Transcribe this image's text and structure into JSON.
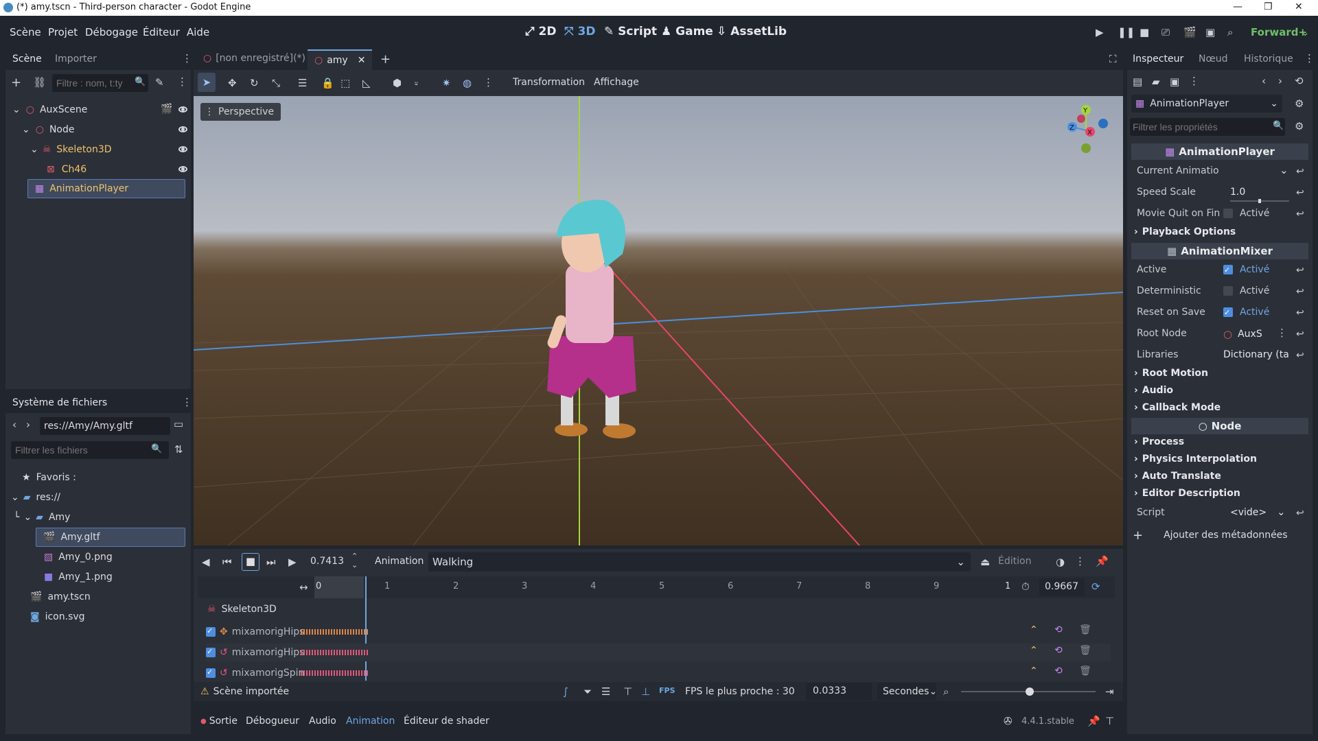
{
  "window": {
    "title": "(*) amy.tscn - Third-person character - Godot Engine"
  },
  "menu": [
    "Scène",
    "Projet",
    "Débogage",
    "Éditeur",
    "Aide"
  ],
  "workspaces": {
    "w2d": "2D",
    "w3d": "3D",
    "script": "Script",
    "game": "Game",
    "assetlib": "AssetLib"
  },
  "renderer": "Forward+",
  "scene_dock": {
    "tabs": [
      "Scène",
      "Importer"
    ],
    "filter_placeholder": "Filtre : nom, t:ty",
    "tree": [
      "AuxScene",
      "Node",
      "Skeleton3D",
      "Ch46",
      "AnimationPlayer"
    ]
  },
  "fs_dock": {
    "title": "Système de fichiers",
    "path": "res://Amy/Amy.gltf",
    "filter_placeholder": "Filtrer les fichiers",
    "items": [
      "Favoris :",
      "res://",
      "Amy",
      "Amy.gltf",
      "Amy_0.png",
      "Amy_1.png",
      "amy.tscn",
      "icon.svg"
    ]
  },
  "editor_tabs": [
    "[non enregistré](*)",
    "amy"
  ],
  "viewport": {
    "toolbar_menus": [
      "Transformation",
      "Affichage"
    ],
    "perspective": "Perspective",
    "gizmo": {
      "y": "Y",
      "x": "X",
      "z": "Z"
    }
  },
  "animation": {
    "time": "0.7413",
    "label": "Animation",
    "current": "Walking",
    "edit": "Édition",
    "ruler": [
      "0",
      "1",
      "2",
      "3",
      "4",
      "5",
      "6",
      "7",
      "8",
      "9",
      "1"
    ],
    "length": "0.9667",
    "group": "Skeleton3D",
    "tracks": [
      "mixamorigHips",
      "mixamorigHips",
      "mixamorigSpin"
    ],
    "warning": "Scène importée",
    "fps_label": "FPS le plus proche : 30",
    "step": "0.0333",
    "unit": "Secondes",
    "zoom": 0.51
  },
  "bottom_tabs": [
    "Sortie",
    "Débogueur",
    "Audio",
    "Animation",
    "Éditeur de shader"
  ],
  "version": "4.4.1.stable",
  "inspector": {
    "tabs": [
      "Inspecteur",
      "Nœud",
      "Historique"
    ],
    "node": "AnimationPlayer",
    "filter_placeholder": "Filtrer les propriétés",
    "groups": {
      "ap": "AnimationPlayer",
      "mixer": "AnimationMixer",
      "node": "Node"
    },
    "props": {
      "current_anim": "Current Animatio",
      "speed_scale": "Speed Scale",
      "speed_value": "1.0",
      "speed_fraction": 0.5,
      "movie_quit": "Movie Quit on Fin",
      "active": "Active",
      "deterministic": "Deterministic",
      "reset_on_save": "Reset on Save",
      "root_node": "Root Node",
      "root_node_val": "AuxS",
      "libraries": "Libraries",
      "libraries_val": "Dictionary (ta",
      "script": "Script",
      "script_val": "<vide>"
    },
    "enabled": "Activé",
    "sections": {
      "playback": "Playback Options",
      "root_motion": "Root Motion",
      "audio": "Audio",
      "callback": "Callback Mode",
      "process": "Process",
      "physics": "Physics Interpolation",
      "auto_translate": "Auto Translate",
      "editor_desc": "Editor Description"
    },
    "add_meta": "Ajouter des métadonnées"
  }
}
